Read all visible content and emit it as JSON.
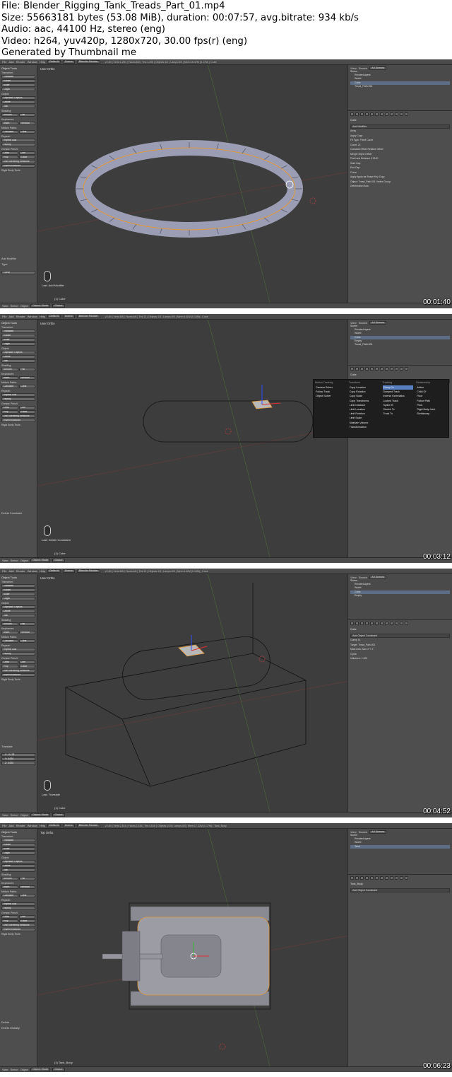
{
  "header": {
    "file": "File: Blender_Rigging_Tank_Treads_Part_01.mp4",
    "size": "Size: 55663181 bytes (53.08 MiB), duration: 00:07:57, avg.bitrate: 934 kb/s",
    "audio": "Audio: aac, 44100 Hz, stereo (eng)",
    "video": "Video: h264, yuv420p, 1280x720, 30.00 fps(r) (eng)",
    "generated": "Generated by Thumbnail me"
  },
  "common": {
    "menus": [
      "File",
      "Add",
      "Render",
      "Window",
      "Help"
    ],
    "layout": "Default",
    "scene": "Scene",
    "engine": "Blender Render",
    "view_menu": "View",
    "select_menu": "Select",
    "object_menu": "Object",
    "mode": "Object Mode",
    "pivot": "Global",
    "tool_title": "Object Tools",
    "transform_label": "Transform:",
    "translate": "Translate",
    "rotate": "Rotate",
    "scale": "Scale",
    "origin": "Origin",
    "object_label": "Object:",
    "duplicate_objects": "Duplicate Objects",
    "delete": "Delete",
    "join": "Join",
    "shading_label": "Shading:",
    "smooth": "Smooth",
    "flat": "Flat",
    "keyframes_label": "Keyframes:",
    "insert": "Insert",
    "remove": "Remove",
    "motion_paths_label": "Motion Paths:",
    "calculate": "Calculate",
    "clear": "Clear",
    "repeat_label": "Repeat:",
    "repeat_last": "Repeat Last",
    "history": "History",
    "grease_pencil_label": "Grease Pencil:",
    "draw": "Draw",
    "line": "Line",
    "poly": "Poly",
    "erase": "Erase",
    "sketching": "Use Sketching Sessions",
    "ruler": "Ruler/Protractor",
    "rigid_body": "Rigid Body Tools",
    "outliner_view": "View",
    "outliner_search": "Search",
    "outliner_scenes": "All Scenes",
    "scene_item": "Scene",
    "render_layers": "RenderLayers",
    "world": "World"
  },
  "frames": [
    {
      "viewport_label": "User Ortho",
      "object_name": "(1) Cube",
      "last_op": "Last: Add Modifier",
      "stats": "v2.69 | Verts:1,200 | Faces:600 | Tris:1,200 | Objects:1/2 | Lamps:0/0 | Mem:15.47M (0.17M) | Cube",
      "outliner_items": [
        "Cube",
        "Tread_Path.001"
      ],
      "timestamp": "00:01:40",
      "side_op": "Add Modifier",
      "side_type": "Type:",
      "side_type_val": "Curve",
      "props": {
        "path": "Cube",
        "panel": "Add Modifier",
        "lines": [
          "Array",
          "Apply    Copy",
          "Fit Type:  Fixed Count",
          "Count: 21",
          "Constant Offset   Relative Offset",
          "Merge   Object Offset",
          "First Last   Distance 0.0100",
          "Start Cap:",
          "End Cap:",
          "Curve",
          "Apply   Apply as Shape Key   Copy",
          "Object:  Tread_Path.001   Vertex Group:",
          "Deformation Axis:"
        ]
      }
    },
    {
      "viewport_label": "User Ortho",
      "object_name": "(1) Cube",
      "last_op": "Last: Delete Constraint",
      "stats": "v2.69 | Verts:8/8 | Faces:6/6 | Tris:12 | Objects:1/3 | Lamps:0/0 | Mem:8.41M (0.10M) | Cube",
      "outliner_items": [
        "Cube",
        "Empty",
        "Tread_Path.001"
      ],
      "timestamp": "00:03:12",
      "side_op": "Delete Constraint",
      "props": {
        "path": "Cube",
        "panel": "Add Object Constraint",
        "lines": []
      },
      "menu": {
        "cols": [
          {
            "title": "Motion Tracking",
            "items": [
              "Camera Solver",
              "Follow Track",
              "Object Solver"
            ]
          },
          {
            "title": "Transform",
            "items": [
              "Copy Location",
              "Copy Rotation",
              "Copy Scale",
              "Copy Transforms",
              "Limit Distance",
              "Limit Location",
              "Limit Rotation",
              "Limit Scale",
              "Maintain Volume",
              "Transformation"
            ]
          },
          {
            "title": "Tracking",
            "items": [
              "Clamp To",
              "Damped Track",
              "Inverse Kinematics",
              "Locked Track",
              "Spline IK",
              "Stretch To",
              "Track To"
            ]
          },
          {
            "title": "Relationship",
            "items": [
              "Action",
              "Child Of",
              "Floor",
              "Follow Path",
              "Pivot",
              "Rigid Body Joint",
              "Shrinkwrap"
            ]
          }
        ]
      }
    },
    {
      "viewport_label": "User Ortho",
      "object_name": "(1) Cube",
      "last_op": "Last: Translate",
      "stats": "v2.69 | Verts:8/8 | Faces:6/6 | Tris:12 | Objects:1/3 | Lamps:0/0 | Mem:8.42M (0.10M) | Cube",
      "outliner_items": [
        "Cube",
        "Empty"
      ],
      "timestamp": "00:04:52",
      "side_op": "Translate",
      "vector": [
        "X: -0.178",
        "Y: 0.000",
        "Z: 0.000"
      ],
      "props": {
        "path": "Cube",
        "panel": "Add Object Constraint",
        "lines": [
          "Clamp To",
          "Target:  Tread_Path.001",
          "Main Axis:   Auto   X   Y   Z",
          "Cyclic",
          "Influence: 1.000"
        ]
      }
    },
    {
      "viewport_label": "Top Ortho",
      "object_name": "(1) Tank_Body",
      "last_op": "",
      "stats": "v2.69 | Verts:2,516 | Faces:2,516 | Tris:4,616 | Objects:1/18 | Lamps:0/0 | Mem:17.22M (1.17M) | Tank_Body",
      "outliner_items": [
        "Tank"
      ],
      "timestamp": "00:06:23",
      "side_op": "Delete",
      "side_type": "Delete Globally",
      "props": {
        "path": "Tank_Body",
        "panel": "Add Object Constraint",
        "lines": []
      }
    }
  ]
}
